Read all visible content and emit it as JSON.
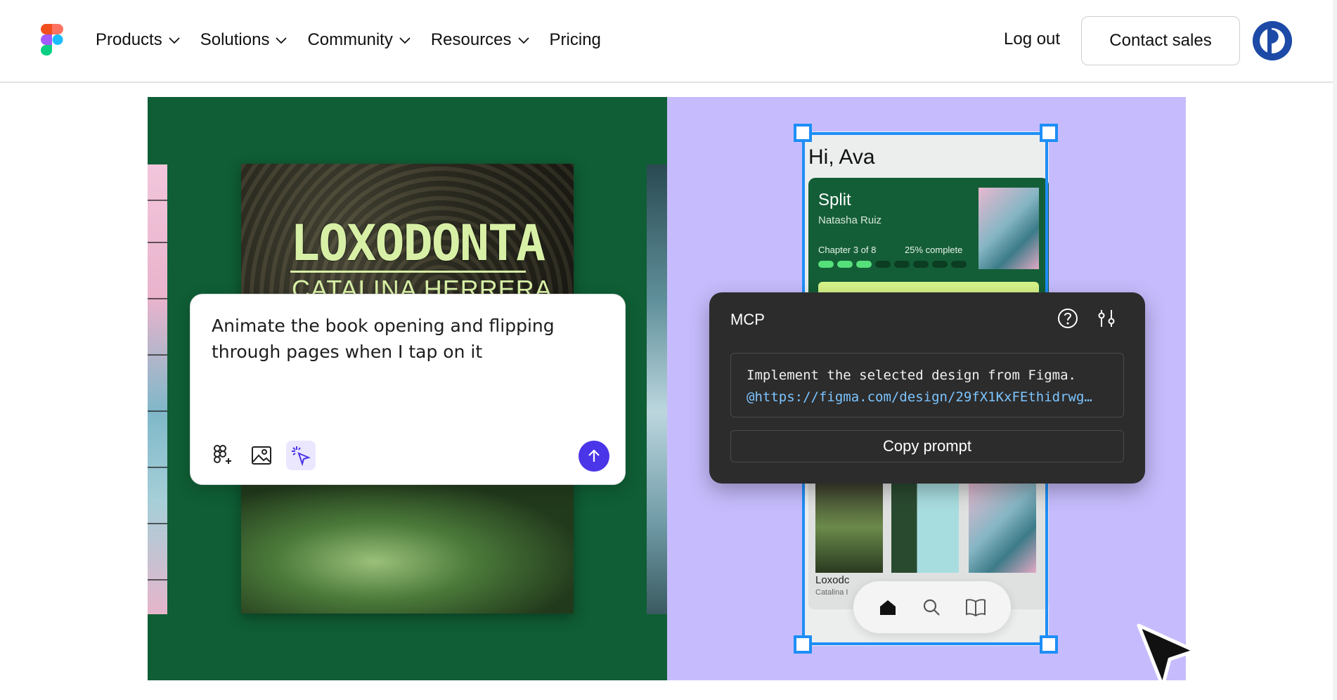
{
  "nav": {
    "items": [
      {
        "label": "Products",
        "has_dropdown": true
      },
      {
        "label": "Solutions",
        "has_dropdown": true
      },
      {
        "label": "Community",
        "has_dropdown": true
      },
      {
        "label": "Resources",
        "has_dropdown": true
      },
      {
        "label": "Pricing",
        "has_dropdown": false
      }
    ],
    "logout_label": "Log out",
    "contact_label": "Contact sales",
    "icons": [
      "figma-logo-icon",
      "chevron-down-icon",
      "avatar-icon"
    ]
  },
  "hero_left": {
    "book_title": "LOXODONTA",
    "book_author": "CATALINA HERRERA",
    "prompt_text": "Animate the book opening and flipping through pages when I tap on it",
    "tools": [
      "figma-plus-icon",
      "image-icon",
      "sparkle-cursor-icon"
    ],
    "send_icon": "arrow-up-icon",
    "colors": {
      "background": "#0f5e35",
      "send_button": "#4a35e8"
    }
  },
  "hero_right": {
    "greeting": "Hi, Ava",
    "reading": {
      "title": "Split",
      "author": "Natasha Ruiz",
      "chapter": "Chapter 3 of 8",
      "progress_label": "25% complete",
      "segments_total": 8,
      "segments_done": 3
    },
    "mcp": {
      "title": "MCP",
      "code_line1": "Implement the selected design from Figma.",
      "code_line2": "@https://figma.com/design/29fX1KxFEthidrwg…",
      "copy_label": "Copy prompt"
    },
    "shelf": {
      "first_label": "Loxodc",
      "first_sub": "Catalina I"
    },
    "colors": {
      "background": "#c6bcfd",
      "selection": "#1e8ef7",
      "card": "#145e37",
      "progress_on": "#56e07a"
    }
  }
}
